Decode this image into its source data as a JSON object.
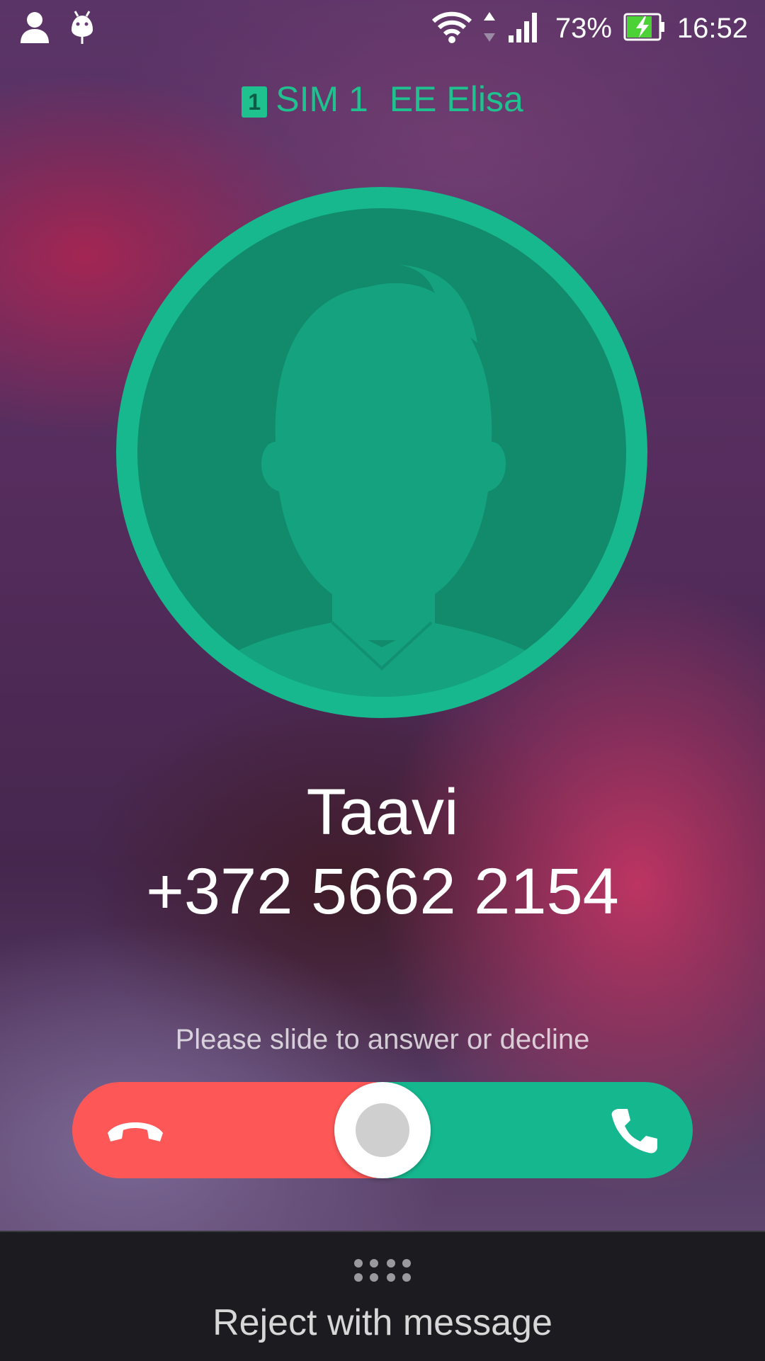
{
  "status_bar": {
    "left_icons": [
      "person-icon",
      "android-debug-icon"
    ],
    "right_icons": [
      "wifi-icon",
      "data-arrows-icon",
      "signal-icon",
      "battery-charging-icon"
    ],
    "battery_percent": "73%",
    "time": "16:52"
  },
  "carrier": {
    "sim_badge": "1",
    "sim_label": "SIM 1",
    "operator": "EE Elisa",
    "color": "#1fc18e"
  },
  "caller": {
    "name": "Taavi",
    "number": "+372 5662 2154",
    "avatar_icon": "default-person-avatar-icon"
  },
  "slider": {
    "hint": "Please slide to answer or decline",
    "decline_icon": "hang-up-icon",
    "answer_icon": "phone-icon",
    "decline_color": "#fd5757",
    "answer_color": "#15b78e"
  },
  "bottom": {
    "icon": "dots-grid-icon",
    "label": "Reject with message"
  }
}
